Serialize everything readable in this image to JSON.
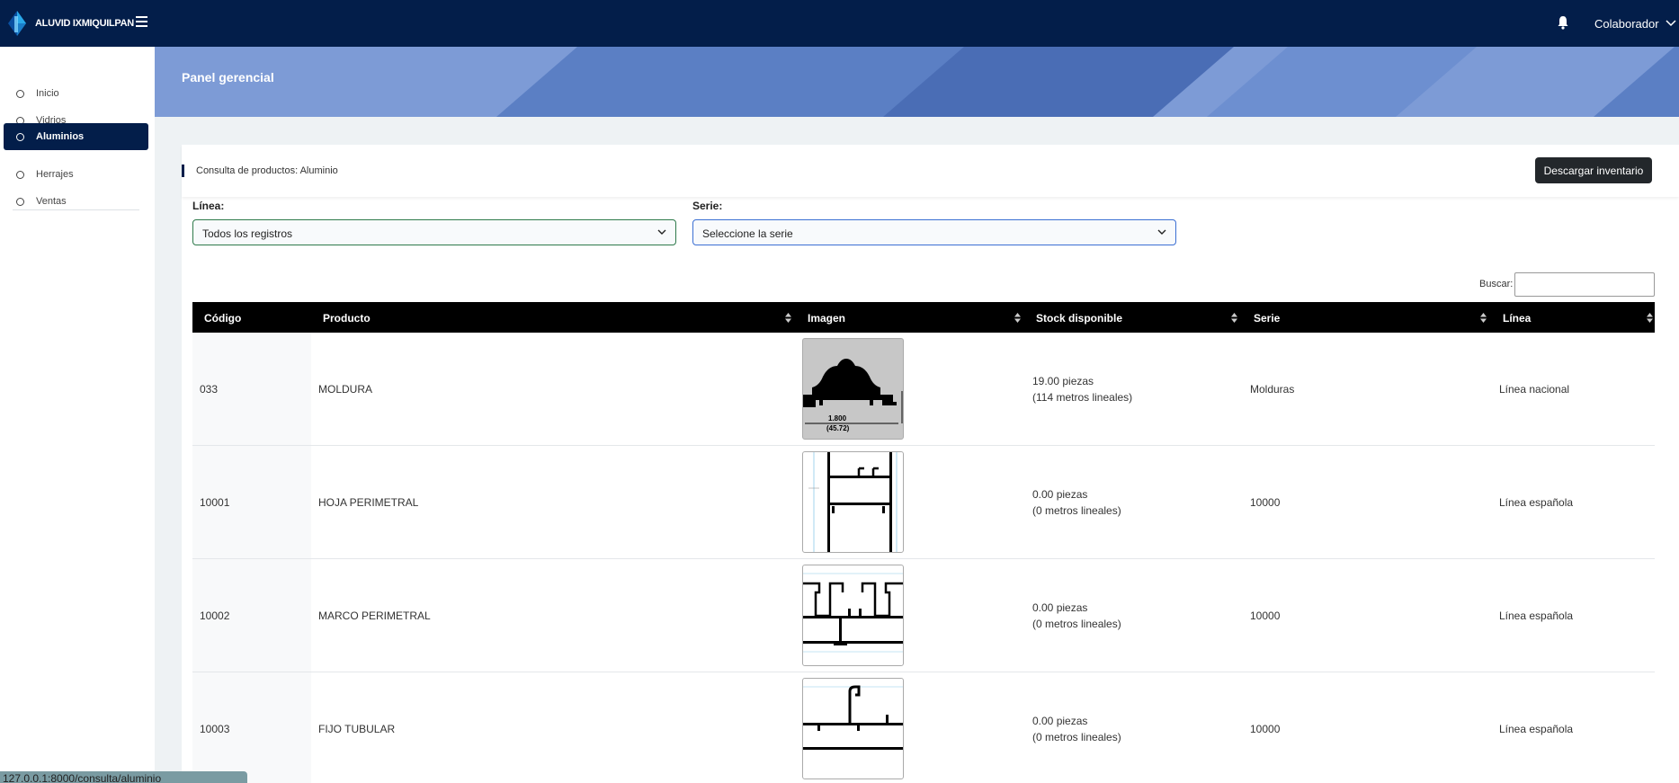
{
  "app": {
    "brand": "ALUVID IXMIQUILPAN",
    "user": "Colaborador"
  },
  "icons": {
    "logo": "diamond-logo",
    "menu": "hamburger-icon",
    "notifications": "bell-icon",
    "user_menu": "chevron-down-icon",
    "nav_bullet": "circle-icon",
    "sort": "sort-icon"
  },
  "colors": {
    "topbar": "#031e4a",
    "active_nav": "#031e4a",
    "banner": "#7d9bd6",
    "table_header": "#000000",
    "download_button": "#23272b",
    "linea_border": "#2e7a4b",
    "serie_border": "#3b6fd3"
  },
  "sidebar": {
    "items": [
      {
        "label": "Inicio",
        "active": false
      },
      {
        "label": "Vidrios",
        "active": false
      },
      {
        "label": "Aluminios",
        "active": true
      },
      {
        "label": "Herrajes",
        "active": false
      },
      {
        "label": "Ventas",
        "active": false
      }
    ]
  },
  "banner": {
    "title": "Panel gerencial"
  },
  "card": {
    "title": "Consulta de productos: Aluminio",
    "download_button": "Descargar inventario"
  },
  "filters": {
    "linea": {
      "label": "Línea:",
      "value": "Todos los registros"
    },
    "serie": {
      "label": "Serie:",
      "value": "Seleccione la serie"
    }
  },
  "search": {
    "label": "Buscar:",
    "value": ""
  },
  "table": {
    "columns": [
      "Código",
      "Producto",
      "Imagen",
      "Stock disponible",
      "Serie",
      "Línea"
    ],
    "rows": [
      {
        "code": "033",
        "product": "MOLDURA",
        "stock_pieces": "19.00 piezas",
        "stock_meters": "(114 metros lineales)",
        "serie": "Molduras",
        "linea": "Línea nacional",
        "image_labels": [
          "1.800",
          "(45.72)"
        ]
      },
      {
        "code": "10001",
        "product": "HOJA PERIMETRAL",
        "stock_pieces": "0.00 piezas",
        "stock_meters": "(0 metros lineales)",
        "serie": "10000",
        "linea": "Línea española",
        "image_labels": []
      },
      {
        "code": "10002",
        "product": "MARCO PERIMETRAL",
        "stock_pieces": "0.00 piezas",
        "stock_meters": "(0 metros lineales)",
        "serie": "10000",
        "linea": "Línea española",
        "image_labels": []
      },
      {
        "code": "10003",
        "product": "FIJO TUBULAR",
        "stock_pieces": "0.00 piezas",
        "stock_meters": "(0 metros lineales)",
        "serie": "10000",
        "linea": "Línea española",
        "image_labels": []
      }
    ]
  },
  "status_url": "127.0.0.1:8000/consulta/aluminio"
}
